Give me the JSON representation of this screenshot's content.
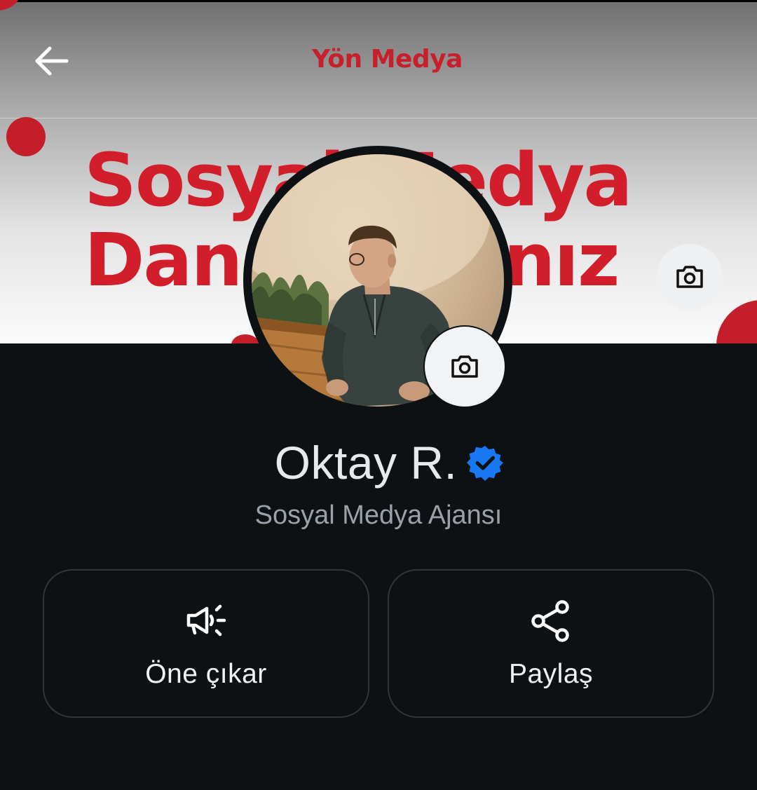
{
  "header": {
    "back_icon": "arrow-left-icon",
    "cover_brand": "Yön Medya",
    "cover_headline_line1": "Sosyal Medya",
    "cover_headline_line2": "Danışmanınız",
    "cover_camera_icon": "camera-icon",
    "brand_color": "#c8202a"
  },
  "profile": {
    "avatar_camera_icon": "camera-icon",
    "name": "Oktay R.",
    "verified_icon": "verified-badge-icon",
    "verified_color": "#1877f2",
    "subtitle": "Sosyal Medya Ajansı"
  },
  "actions": [
    {
      "label": "Öne çıkar",
      "icon": "megaphone-icon"
    },
    {
      "label": "Paylaş",
      "icon": "share-icon"
    }
  ]
}
